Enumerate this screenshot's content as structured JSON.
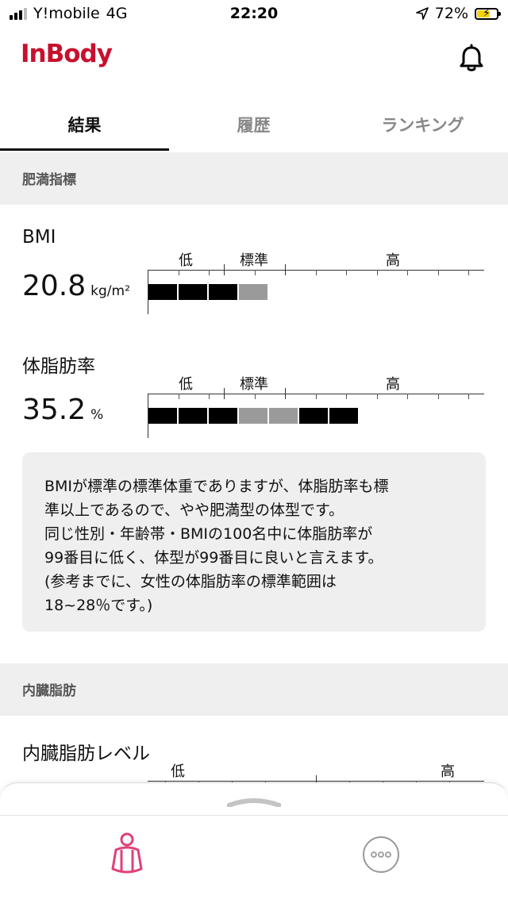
{
  "status_bar": {
    "carrier": "Y!mobile",
    "network": "4G",
    "time": "22:20",
    "battery": "72%",
    "battery_level": 0.72
  },
  "header": {
    "logo": "InBody"
  },
  "tabs": [
    {
      "label": "結果",
      "active": true
    },
    {
      "label": "履歴",
      "active": false
    },
    {
      "label": "ランキング",
      "active": false
    }
  ],
  "obesity": {
    "section_title": "肥満指標",
    "bmi": {
      "label": "BMI",
      "value": "20.8",
      "unit": "kg/m²",
      "zones": [
        "低",
        "標準",
        "高"
      ],
      "segments_dark": 3,
      "segments_gray": 1,
      "segments_dark_after": 0
    },
    "body_fat": {
      "label": "体脂肪率",
      "value": "35.2",
      "unit": "%",
      "zones": [
        "低",
        "標準",
        "高"
      ],
      "segments_dark": 3,
      "segments_gray": 2,
      "segments_dark_after": 2
    },
    "comment": [
      "BMIが標準の標準体重でありますが、体脂肪率も標",
      "準以上であるので、やや肥満型の体型です。",
      "同じ性別・年齢帯・BMIの100名中に体脂肪率が",
      "99番目に低く、体型が99番目に良いと言えます。",
      "(参考までに、女性の体脂肪率の標準範囲は",
      "18~28％です。)"
    ]
  },
  "visceral": {
    "section_title": "内臓脂肪",
    "level": {
      "label": "内臓脂肪レベル",
      "zones": [
        "低",
        "高"
      ]
    }
  },
  "bottom_nav": {
    "items": [
      "body-icon",
      "more-icon"
    ],
    "accent": "#e0407a"
  },
  "colors": {
    "brand": "#c8102e",
    "bar_dark": "#000000",
    "bar_standard": "#9a9a9a"
  }
}
